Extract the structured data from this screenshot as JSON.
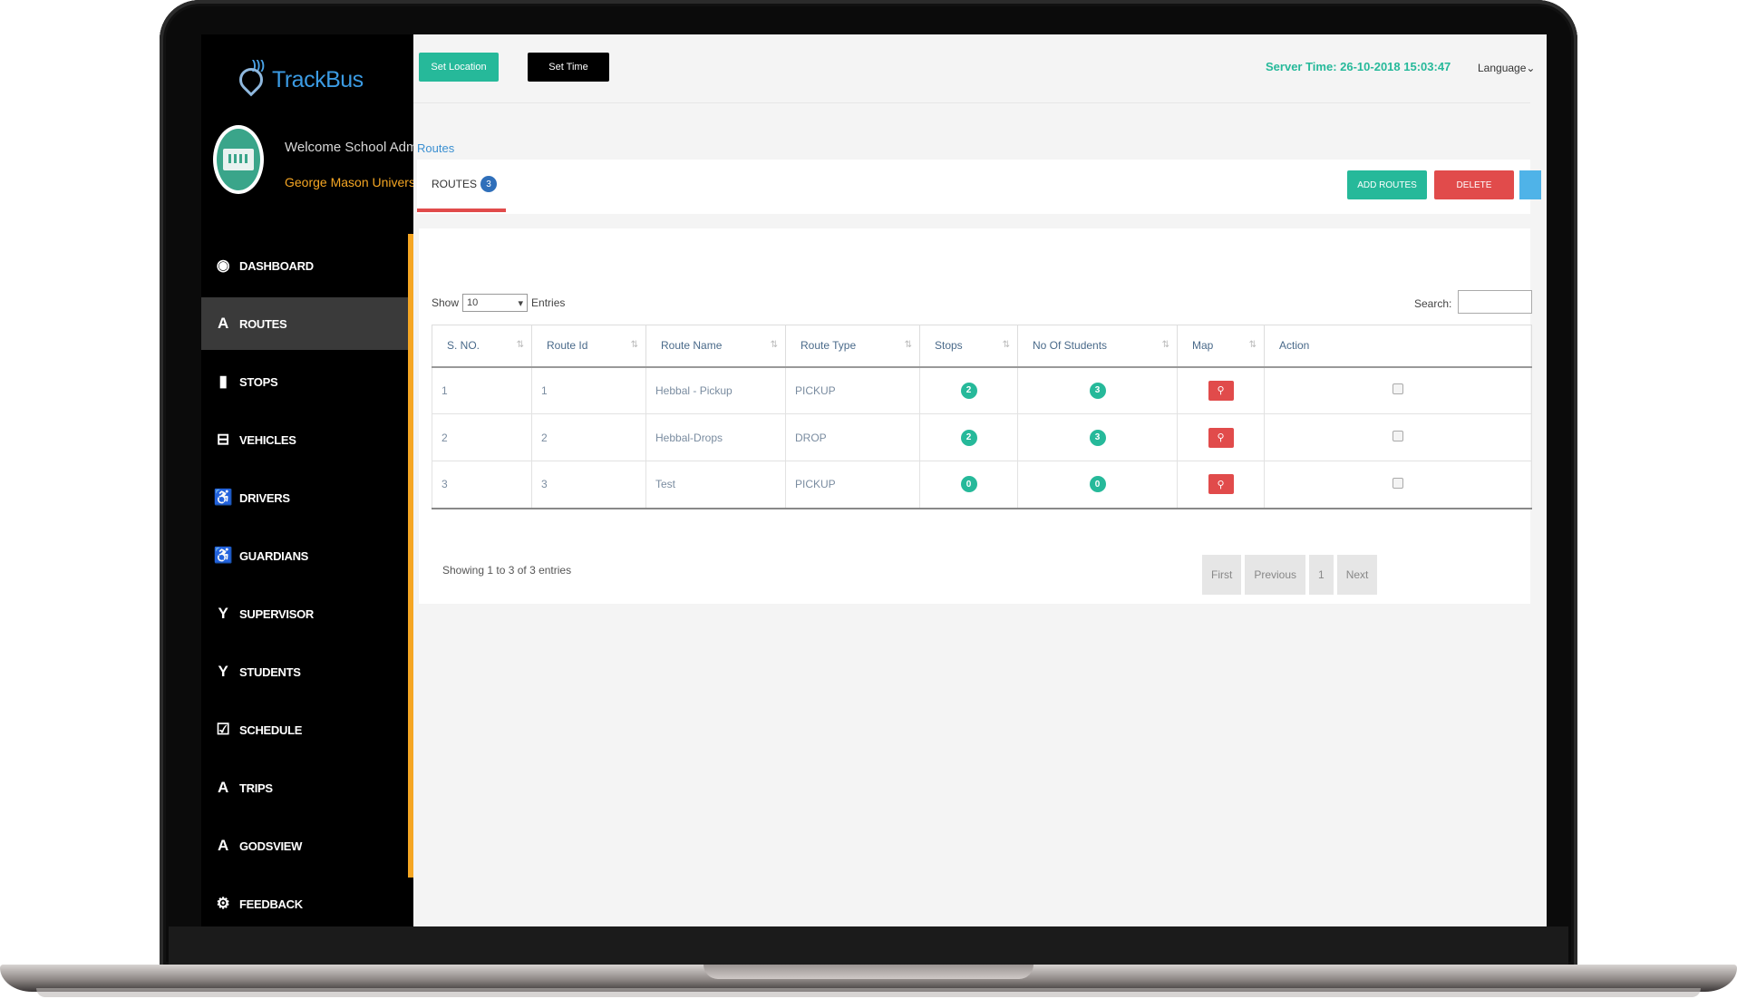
{
  "app": {
    "name": "TrackBus"
  },
  "user": {
    "welcome": "Welcome School Admin",
    "organization": "George Mason University"
  },
  "sidebar": {
    "items": [
      {
        "label": "DASHBOARD",
        "icon": "dashboard-icon",
        "glyph": "◉",
        "active": false
      },
      {
        "label": "ROUTES",
        "icon": "routes-icon",
        "glyph": "A",
        "active": true
      },
      {
        "label": "STOPS",
        "icon": "stops-icon",
        "glyph": "▮",
        "active": false
      },
      {
        "label": "VEHICLES",
        "icon": "bus-icon",
        "glyph": "⊟",
        "active": false
      },
      {
        "label": "DRIVERS",
        "icon": "wheelchair-icon",
        "glyph": "♿",
        "active": false
      },
      {
        "label": "GUARDIANS",
        "icon": "wheelchair-icon",
        "glyph": "♿",
        "active": false
      },
      {
        "label": "SUPERVISOR",
        "icon": "person-icon",
        "glyph": "Y",
        "active": false
      },
      {
        "label": "STUDENTS",
        "icon": "person-icon",
        "glyph": "Y",
        "active": false
      },
      {
        "label": "SCHEDULE",
        "icon": "calendar-check-icon",
        "glyph": "☑",
        "active": false
      },
      {
        "label": "TRIPS",
        "icon": "road-icon",
        "glyph": "A",
        "active": false
      },
      {
        "label": "GODSVIEW",
        "icon": "road-icon",
        "glyph": "A",
        "active": false
      },
      {
        "label": "FEEDBACK",
        "icon": "gear-icon",
        "glyph": "⚙",
        "active": false
      }
    ]
  },
  "topbar": {
    "set_location": "Set Location",
    "set_time": "Set Time",
    "server_time": "Server Time: 26-10-2018 15:03:47",
    "language": "Language"
  },
  "breadcrumb": "Routes",
  "tab": {
    "label": "ROUTES",
    "count": "3"
  },
  "actions": {
    "add": "ADD ROUTES",
    "delete": "DELETE"
  },
  "table_controls": {
    "show": "Show",
    "entries_value": "10",
    "entries": "Entries",
    "search": "Search:"
  },
  "table": {
    "headers": [
      "S. NO.",
      "Route Id",
      "Route Name",
      "Route Type",
      "Stops",
      "No Of Students",
      "Map",
      "Action"
    ],
    "rows": [
      {
        "sno": "1",
        "route_id": "1",
        "route_name": "Hebbal - Pickup",
        "route_type": "PICKUP",
        "stops": "2",
        "students": "3"
      },
      {
        "sno": "2",
        "route_id": "2",
        "route_name": "Hebbal-Drops",
        "route_type": "DROP",
        "stops": "2",
        "students": "3"
      },
      {
        "sno": "3",
        "route_id": "3",
        "route_name": "Test",
        "route_type": "PICKUP",
        "stops": "0",
        "students": "0"
      }
    ]
  },
  "footer": {
    "showing": "Showing 1 to 3 of 3 entries"
  },
  "pagination": {
    "first": "First",
    "previous": "Previous",
    "page": "1",
    "next": "Next"
  },
  "colors": {
    "green": "#26b99a",
    "red": "#e14b4b",
    "accent": "#f5a623",
    "blue": "#2f6fba"
  }
}
